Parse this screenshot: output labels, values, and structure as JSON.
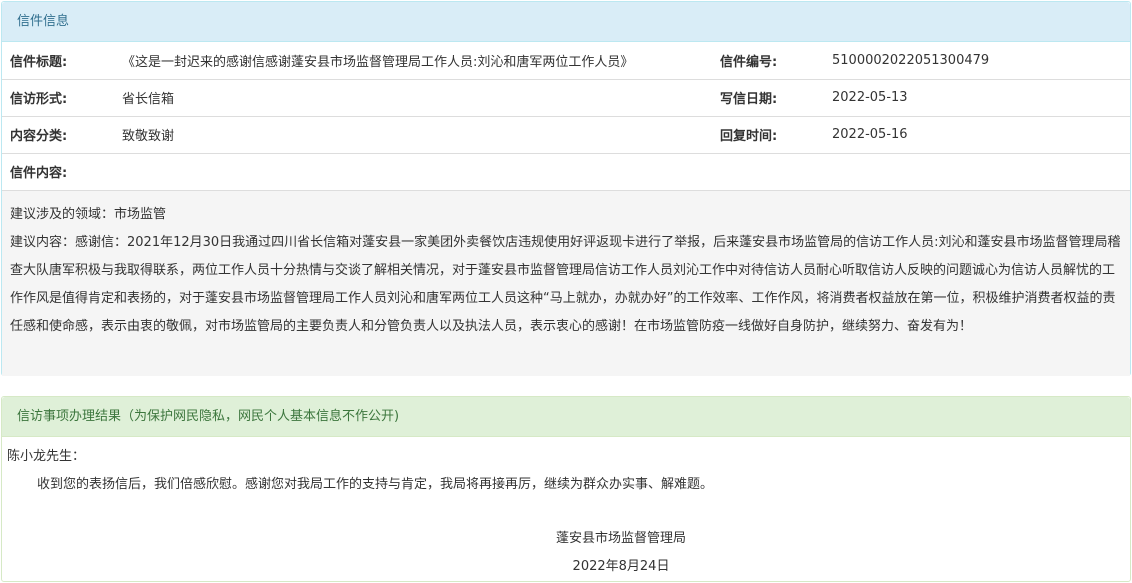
{
  "letter_info": {
    "heading": "信件信息",
    "title_label": "信件标题:",
    "title_value": "《这是一封迟来的感谢信感谢蓬安县市场监督管理局工作人员:刘沁和唐军两位工作人员》",
    "number_label": "信件编号:",
    "number_value": "5100002022051300479",
    "form_label": "信访形式:",
    "form_value": "省长信箱",
    "date_label": "写信日期:",
    "date_value": "2022-05-13",
    "category_label": "内容分类:",
    "category_value": "致敬致谢",
    "reply_time_label": "回复时间:",
    "reply_time_value": "2022-05-16",
    "content_label": "信件内容:",
    "domain_line": "建议涉及的领域：市场监管",
    "content_text": "建议内容：感谢信：2021年12月30日我通过四川省长信箱对蓬安县一家美团外卖餐饮店违规使用好评返现卡进行了举报，后来蓬安县市场监管局的信访工作人员:刘沁和蓬安县市场监督管理局稽查大队唐军积极与我取得联系，两位工作人员十分热情与交谈了解相关情况，对于蓬安县市监督管理局信访工作人员刘沁工作中对待信访人员耐心听取信访人反映的问题诚心为信访人员解忧的工作作风是值得肯定和表扬的，对于蓬安县市场监督管理局工作人员刘沁和唐军两位工人员这种“马上就办，办就办好”的工作效率、工作作风，将消费者权益放在第一位，积极维护消费者权益的责任感和使命感，表示由衷的敬佩，对市场监管局的主要负责人和分管负责人以及执法人员，表示衷心的感谢！在市场监管防疫一线做好自身防护，继续努力、奋发有为！"
  },
  "result": {
    "heading": "信访事项办理结果（为保护网民隐私，网民个人基本信息不作公开)",
    "salutation": "陈小龙先生：",
    "body": "收到您的表扬信后，我们倍感欣慰。感谢您对我局工作的支持与肯定，我局将再接再厉，继续为群众办实事、解难题。",
    "org": "蓬安县市场监督管理局",
    "date": "2022年8月24日"
  },
  "colors": {
    "info_heading_bg": "#d9edf7",
    "info_heading_text": "#31708f",
    "success_heading_bg": "#dff0d8",
    "success_heading_text": "#3c763d"
  }
}
